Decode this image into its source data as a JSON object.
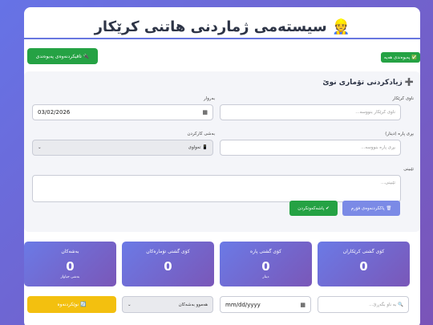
{
  "header": {
    "title": "👷 سیستەمی ژماردنی هاتنی کرێکار"
  },
  "top_actions": {
    "sync_button": "🔌 تاقیکردنەوەی پەیوەندی",
    "status_badge": "✅ پەیوەندی هەیە"
  },
  "form": {
    "heading": "زیادکردنی تۆماری نوێ",
    "heading_icon": "➕",
    "name_label": "ناوی کرێکار",
    "name_placeholder": "ناوی کرێکار بنووسە...",
    "date_label": "بەروار",
    "date_value": "03/02/2026",
    "amount_label": "بڕی پارە (دینار)",
    "amount_placeholder": "بڕی پارە بنووسە...",
    "shift_label": "بەشی کارکردن",
    "shift_value": "📱 تەواوی",
    "notes_label": "تێبینی",
    "notes_placeholder": "تێبینی...",
    "save_button": "✔ پاشەکەوتکردن",
    "clear_button": "🗑 پاککردنەوەی فۆرم"
  },
  "stats": [
    {
      "label": "کۆی گشتی کرێکاران",
      "value": "0",
      "sub": ""
    },
    {
      "label": "کۆی گشتی پارە",
      "value": "0",
      "sub": "دینار"
    },
    {
      "label": "کۆی گشتی تۆمارەکان",
      "value": "0",
      "sub": ""
    },
    {
      "label": "بەشەکان",
      "value": "0",
      "sub": "بەشی جیاواز"
    }
  ],
  "filters": {
    "search_placeholder": "🔍 بە ناو بگەڕێ...",
    "date_placeholder": "mm/dd/yyyy",
    "shift_select": "هەموو بەشەکان",
    "refresh_button": "🔄 نوێکردنەوە"
  },
  "colors": {
    "accent": "#6877e0",
    "success": "#25a244",
    "warning": "#f3c00f"
  }
}
